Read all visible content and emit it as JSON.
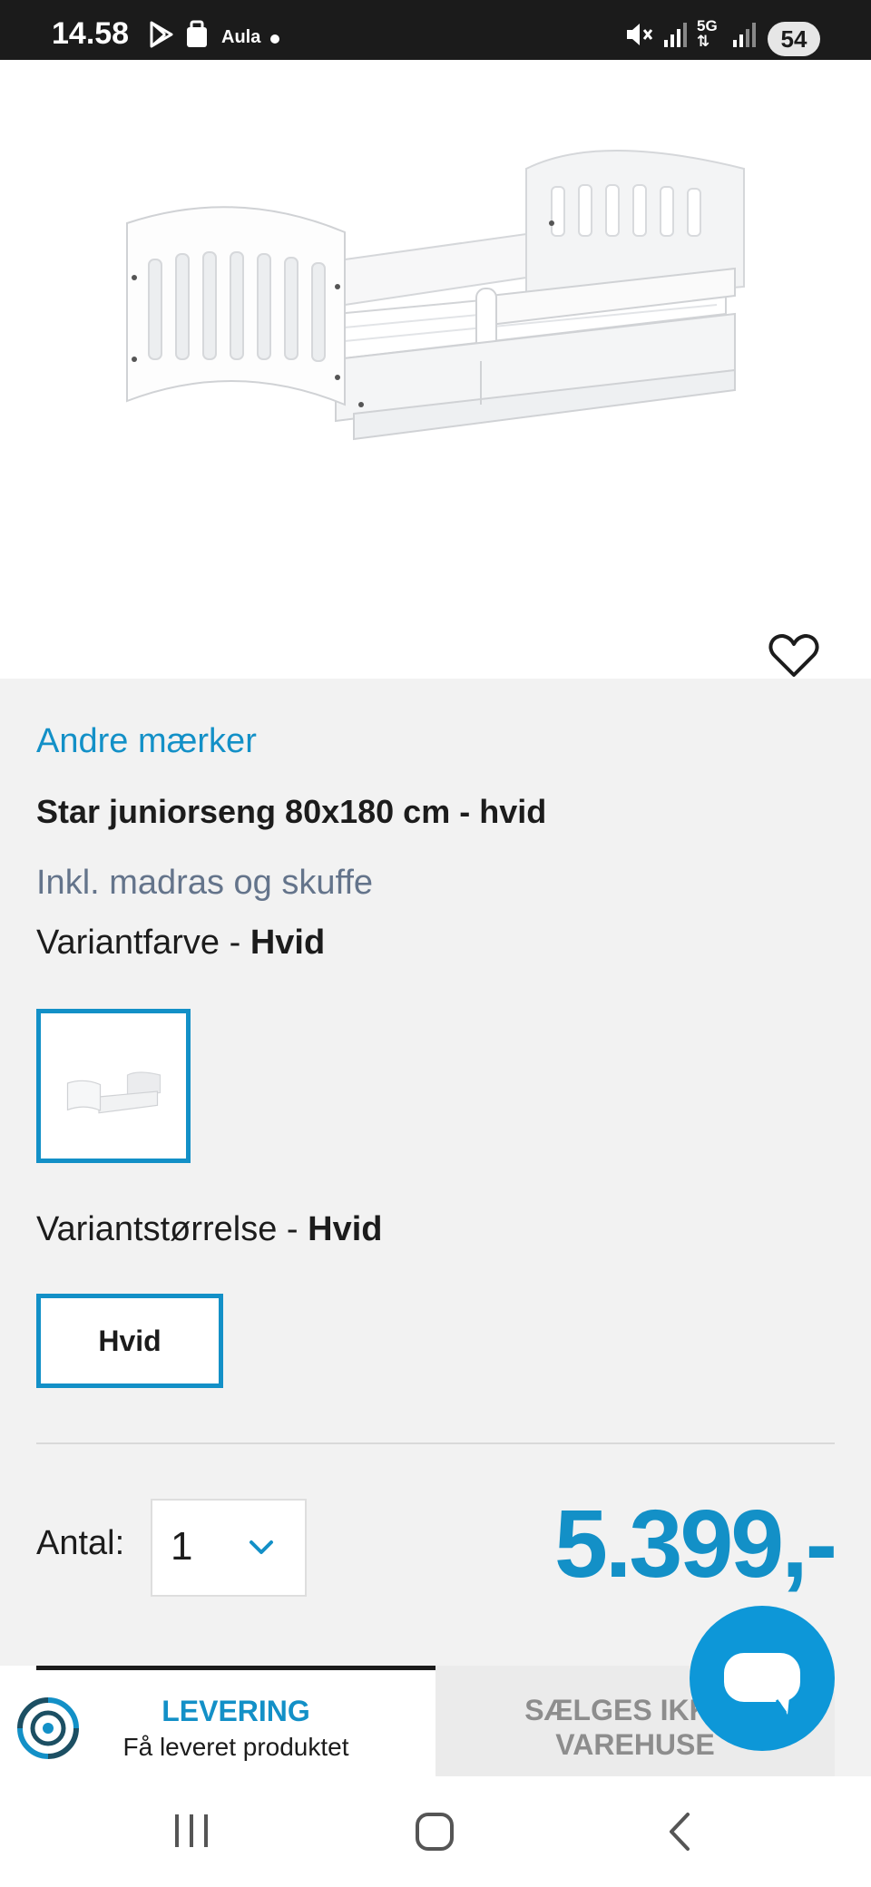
{
  "status_bar": {
    "time": "14.58",
    "app_label": "Aula",
    "network": "5G",
    "battery": "54"
  },
  "gallery": {
    "image_alt": "Star juniorseng hvid",
    "slide_count": 5,
    "active_slide": 2
  },
  "product": {
    "brand": "Andre mærker",
    "title": "Star juniorseng 80x180 cm - hvid",
    "subtitle": "Inkl. madras og skuffe",
    "variant_color_label": "Variantfarve - ",
    "variant_color_value": "Hvid",
    "variant_size_label": "Variantstørrelse - ",
    "variant_size_value": "Hvid",
    "size_option": "Hvid",
    "quantity_label": "Antal:",
    "quantity_value": "1",
    "price": "5.399,-"
  },
  "delivery_tabs": {
    "delivery_title": "LEVERING",
    "delivery_subtitle": "Få leveret produktet",
    "store_line1": "SÆLGES IKKE I",
    "store_line2": "VAREHUSE"
  },
  "colors": {
    "accent": "#1390c7",
    "chat_button": "#0d97d8",
    "panel_bg": "#f2f2f2"
  },
  "icons": [
    "play-store-icon",
    "notification-icon",
    "mute-icon",
    "signal-icon",
    "heart-icon",
    "chevron-down-icon",
    "delivery-icon",
    "chat-icon",
    "recents-icon",
    "home-icon",
    "back-icon"
  ]
}
